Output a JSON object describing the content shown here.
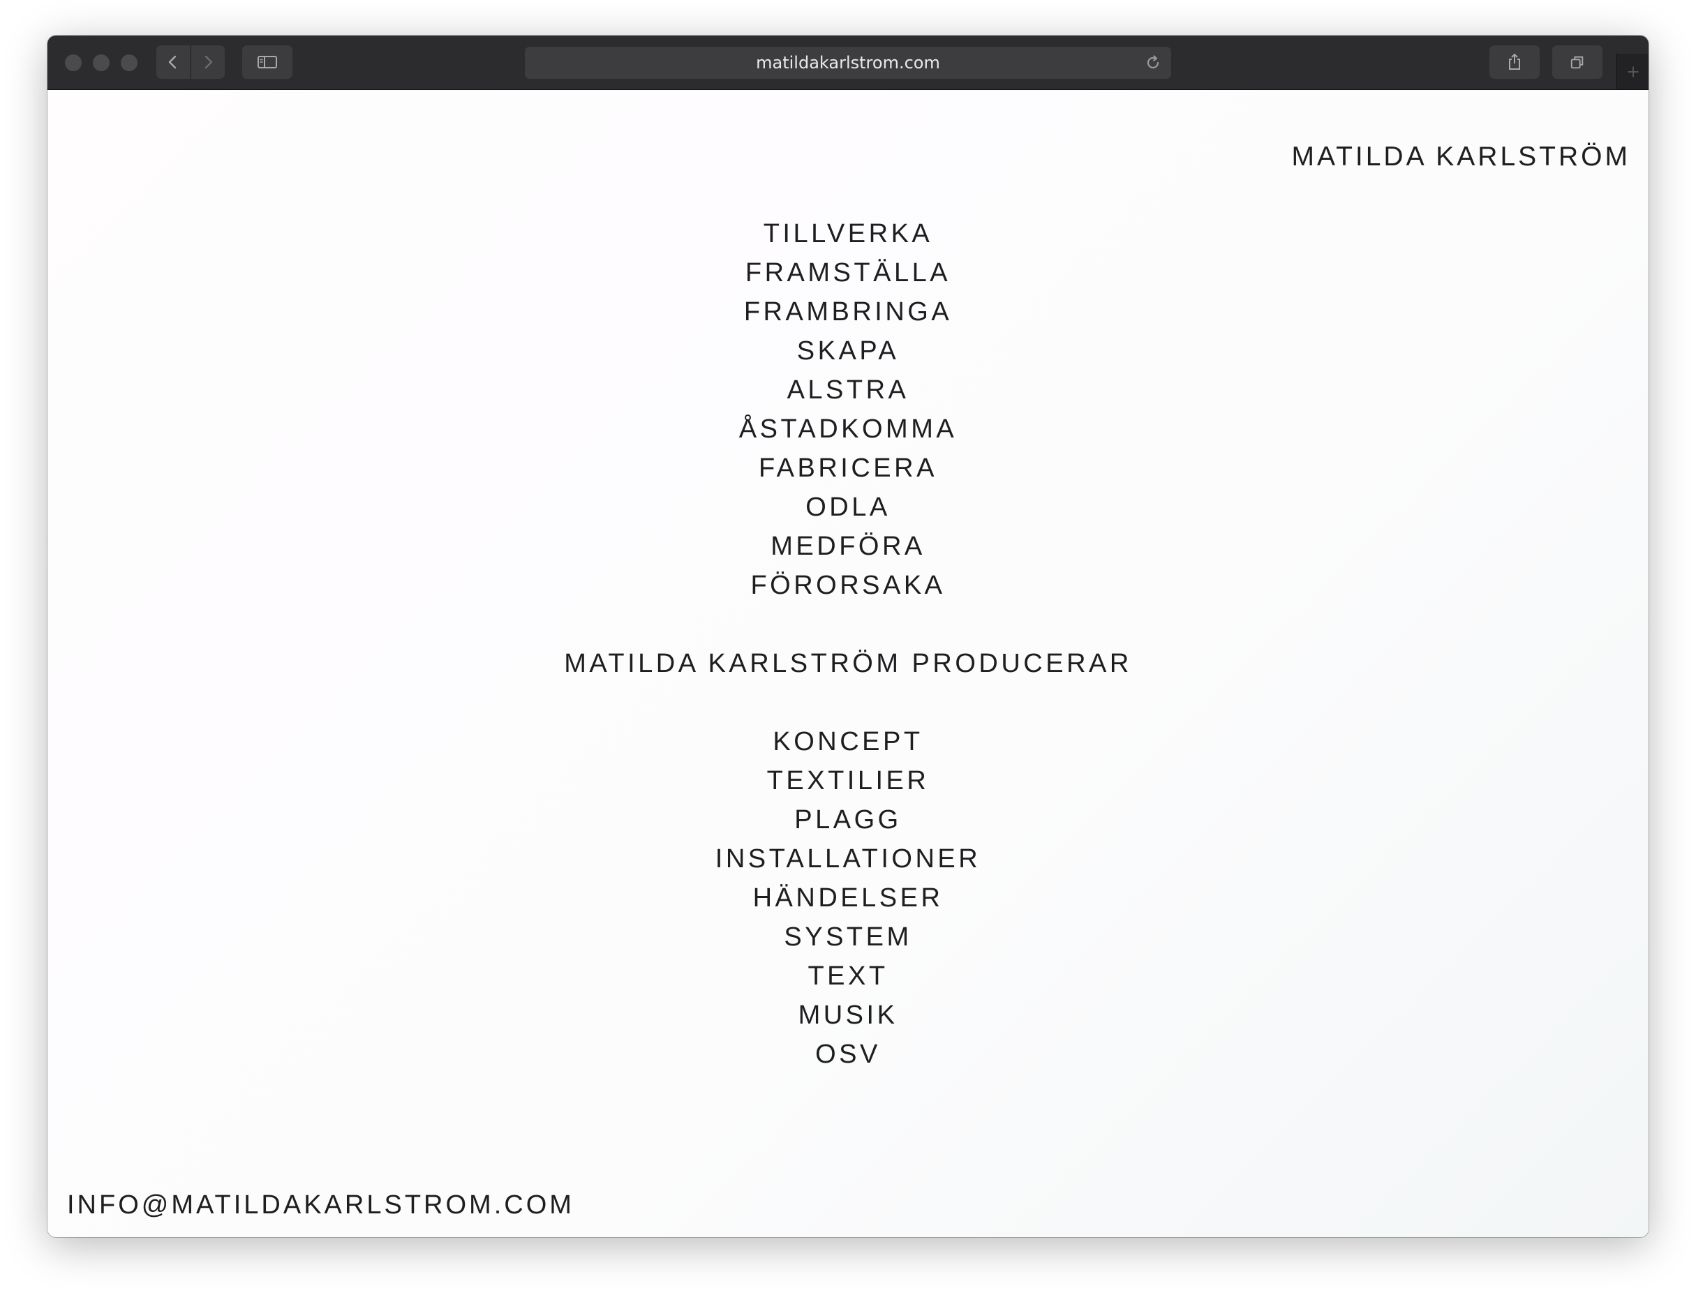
{
  "browser": {
    "url": "matildakarlstrom.com"
  },
  "site": {
    "title": "MATILDA KARLSTRÖM",
    "verbs": [
      "TILLVERKA",
      "FRAMSTÄLLA",
      "FRAMBRINGA",
      "SKAPA",
      "ALSTRA",
      "ÅSTADKOMMA",
      "FABRICERA",
      "ODLA",
      "MEDFÖRA",
      "FÖRORSAKA"
    ],
    "tagline": "MATILDA KARLSTRÖM PRODUCERAR",
    "products": [
      "KONCEPT",
      "TEXTILIER",
      "PLAGG",
      "INSTALLATIONER",
      "HÄNDELSER",
      "SYSTEM",
      "TEXT",
      "MUSIK",
      "OSV"
    ],
    "email": "INFO@MATILDAKARLSTROM.COM"
  }
}
